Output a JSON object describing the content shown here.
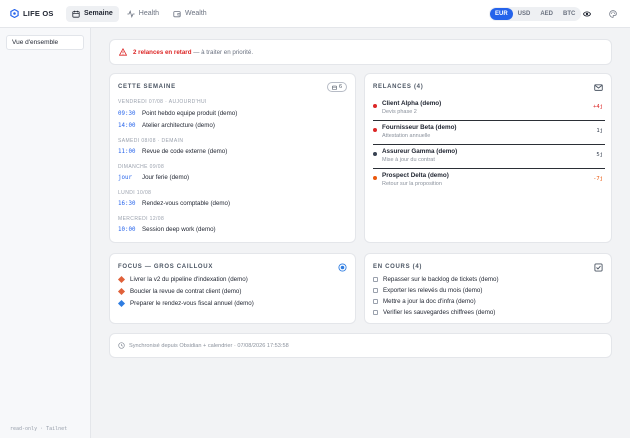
{
  "app": {
    "name": "LIFE OS"
  },
  "nav": [
    {
      "label": "Semaine",
      "icon": "calendar-icon",
      "active": true
    },
    {
      "label": "Health",
      "icon": "activity-icon",
      "active": false
    },
    {
      "label": "Wealth",
      "icon": "wallet-icon",
      "active": false
    }
  ],
  "currency": {
    "options": [
      "EUR",
      "USD",
      "AED",
      "BTC"
    ],
    "selected": "EUR"
  },
  "top_actions": [
    "eye-icon",
    "palette-icon"
  ],
  "sidebar": {
    "items": [
      {
        "label": "Vue d'ensemble",
        "active": true
      }
    ],
    "footer": "read-only · Tailnet"
  },
  "alert": {
    "highlight": "2 relances en retard",
    "rest": " — à traiter en priorité."
  },
  "week": {
    "title": "Cette semaine",
    "badge": "6",
    "days": [
      {
        "label": "Vendredi 07/08 · Aujourd'hui",
        "events": [
          {
            "time": "09:30",
            "title": "Point hebdo equipe produit (demo)"
          },
          {
            "time": "14:00",
            "title": "Atelier architecture (demo)"
          }
        ]
      },
      {
        "label": "Samedi 08/08 · Demain",
        "events": [
          {
            "time": "11:00",
            "title": "Revue de code externe (demo)"
          }
        ]
      },
      {
        "label": "Dimanche 09/08",
        "events": [
          {
            "time": "jour",
            "title": "Jour ferie (demo)"
          }
        ]
      },
      {
        "label": "Lundi 10/08",
        "events": [
          {
            "time": "16:30",
            "title": "Rendez-vous comptable (demo)"
          }
        ]
      },
      {
        "label": "Mercredi 12/08",
        "events": [
          {
            "time": "10:00",
            "title": "Session deep work (demo)"
          }
        ]
      }
    ]
  },
  "relances": {
    "title": "Relances (4)",
    "items": [
      {
        "name": "Client Alpha (demo)",
        "sub": "Devis phase 2",
        "delta": "+4j",
        "color": "#dc2626"
      },
      {
        "name": "Fournisseur Beta (demo)",
        "sub": "Attestation annuelle",
        "delta": "1j",
        "color": "#dc2626"
      },
      {
        "name": "Assureur Gamma (demo)",
        "sub": "Mise à jour du contrat",
        "delta": "5j",
        "color": "#374151"
      },
      {
        "name": "Prospect Delta (demo)",
        "sub": "Retour sur la proposition",
        "delta": "-7j",
        "color": "#ea580c"
      }
    ]
  },
  "focus": {
    "title": "Focus — gros cailloux",
    "items": [
      {
        "label": "Livrer la v2 du pipeline d'indexation (demo)",
        "color": "#e0613a"
      },
      {
        "label": "Boucler la revue de contrat client (demo)",
        "color": "#e0613a"
      },
      {
        "label": "Preparer le rendez-vous fiscal annuel (demo)",
        "color": "#2f7de1"
      }
    ]
  },
  "encours": {
    "title": "En cours (4)",
    "items": [
      "Repasser sur le backlog de tickets (demo)",
      "Exporter les relevés du mois (demo)",
      "Mettre a jour la doc d'infra (demo)",
      "Verifier les sauvegardes chiffrees (demo)"
    ]
  },
  "sync": {
    "text": "Synchronisé depuis Obsidian + calendrier · 07/08/2026 17:53:58"
  },
  "colors": {
    "accent": "#2563eb",
    "danger": "#dc2626"
  }
}
